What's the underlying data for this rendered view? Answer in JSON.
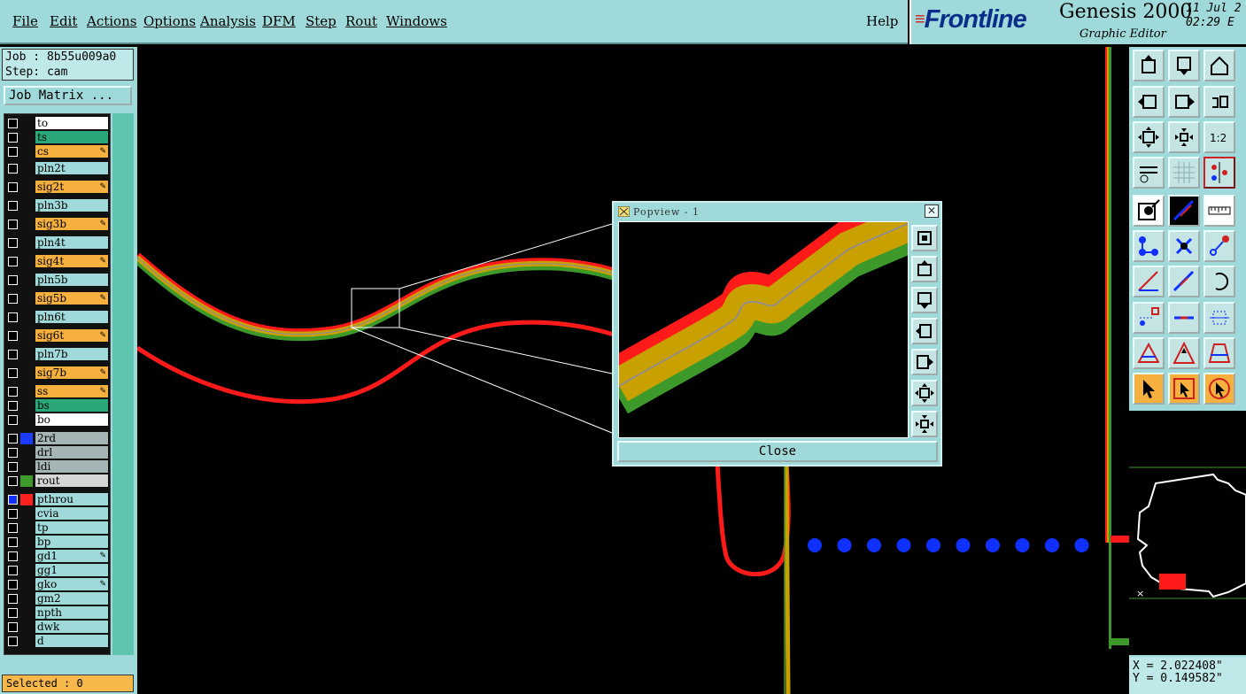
{
  "menu": {
    "items": [
      "File",
      "Edit",
      "Actions",
      "Options",
      "Analysis",
      "DFM",
      "Step",
      "Rout",
      "Windows"
    ],
    "help": "Help"
  },
  "brand": {
    "logo": "Frontline",
    "product": "Genesis 2000",
    "subtitle": "Graphic Editor",
    "date": "11 Jul 2",
    "time": "02:29 E"
  },
  "job": {
    "job_label": "Job : 8b55u009a0",
    "step_label": "Step: cam",
    "matrix_button": "Job Matrix ..."
  },
  "layers": [
    {
      "name": "to",
      "color": "#ffffff"
    },
    {
      "name": "ts",
      "color": "#2aa87a"
    },
    {
      "name": "cs",
      "color": "#f5b03e",
      "arrow": true
    },
    {
      "name": "pln2t",
      "color": "#9fd9d9"
    },
    {
      "name": "sig2t",
      "color": "#f5b03e",
      "arrow": true
    },
    {
      "name": "pln3b",
      "color": "#9fd9d9"
    },
    {
      "name": "sig3b",
      "color": "#f5b03e",
      "arrow": true
    },
    {
      "name": "pln4t",
      "color": "#9fd9d9"
    },
    {
      "name": "sig4t",
      "color": "#f5b03e",
      "arrow": true
    },
    {
      "name": "pln5b",
      "color": "#9fd9d9"
    },
    {
      "name": "sig5b",
      "color": "#f5b03e",
      "arrow": true
    },
    {
      "name": "pln6t",
      "color": "#9fd9d9"
    },
    {
      "name": "sig6t",
      "color": "#f5b03e",
      "arrow": true
    },
    {
      "name": "pln7b",
      "color": "#9fd9d9"
    },
    {
      "name": "sig7b",
      "color": "#f5b03e",
      "arrow": true
    },
    {
      "name": "ss",
      "color": "#f5b03e",
      "arrow": true
    },
    {
      "name": "bs",
      "color": "#2aa87a"
    },
    {
      "name": "bo",
      "color": "#ffffff"
    },
    {
      "name": "2rd",
      "color": "#a5b5b5",
      "swatch": "#1a3cff"
    },
    {
      "name": "drl",
      "color": "#a5b5b5"
    },
    {
      "name": "ldi",
      "color": "#a5b5b5"
    },
    {
      "name": "rout",
      "color": "#d5d5d5",
      "swatch": "#3d9a2a"
    },
    {
      "name": "pthrou",
      "color": "#9fd9d9",
      "swatch": "#ff2020",
      "active": true
    },
    {
      "name": "cvia",
      "color": "#9fd9d9"
    },
    {
      "name": "tp",
      "color": "#9fd9d9"
    },
    {
      "name": "bp",
      "color": "#9fd9d9"
    },
    {
      "name": "gd1",
      "color": "#9fd9d9",
      "arrow": true
    },
    {
      "name": "gg1",
      "color": "#9fd9d9"
    },
    {
      "name": "gko",
      "color": "#9fd9d9",
      "arrow": true
    },
    {
      "name": "gm2",
      "color": "#9fd9d9"
    },
    {
      "name": "npth",
      "color": "#9fd9d9"
    },
    {
      "name": "dwk",
      "color": "#9fd9d9"
    },
    {
      "name": "d",
      "color": "#9fd9d9"
    }
  ],
  "status": {
    "selected": "Selected : 0"
  },
  "coords": {
    "x": "X = 2.022408\"",
    "y": "Y = 0.149582\""
  },
  "popview": {
    "title": "Popview - 1",
    "close_label": "Close"
  },
  "colors": {
    "panel": "#9fd9d9",
    "trace_red": "#ff1a1a",
    "trace_gold": "#c8a000",
    "trace_green": "#4aa01a",
    "via_blue": "#1030ff"
  }
}
